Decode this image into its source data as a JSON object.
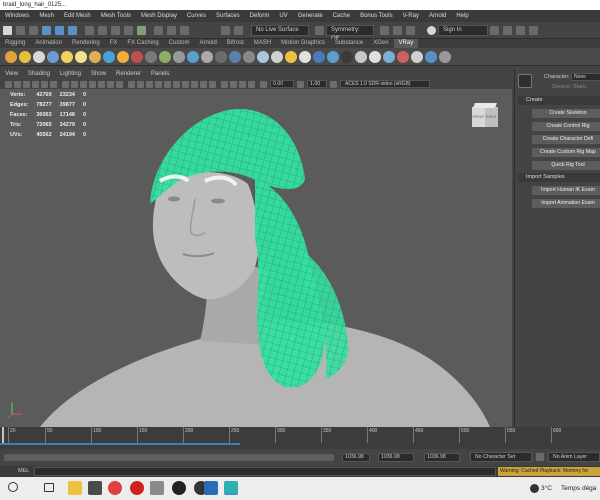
{
  "title_bar": {
    "text": "braid_long_hair_0125..."
  },
  "menubar": [
    "Windows",
    "Mesh",
    "Edit Mesh",
    "Mesh Tools",
    "Mesh Display",
    "Curves",
    "Surfaces",
    "Deform",
    "UV",
    "Generate",
    "Cache",
    "Bonus Tools",
    "V-Ray",
    "Arnold",
    "Help"
  ],
  "statusline": {
    "live_surface": "No Live Surface",
    "symmetry": "Symmetry: Off",
    "sign_in": "Sign In"
  },
  "shelf_tabs": [
    "Rigging",
    "Animation",
    "Rendering",
    "FX",
    "FX Caching",
    "Custom",
    "Arnold",
    "Bifrost",
    "MASH",
    "Motion Graphics",
    "Substance",
    "XGen",
    "VRay"
  ],
  "shelf_active_tab": "VRay",
  "panel_menu": [
    "View",
    "Shading",
    "Lighting",
    "Show",
    "Renderer",
    "Panels"
  ],
  "viewport_toolbar": {
    "field_a": "0.00",
    "field_b": "1.00",
    "color_space": "ACES 1.0 SDR-video (sRGB)"
  },
  "hud": {
    "rows": [
      {
        "label": "Verts:",
        "v1": "42769",
        "v2": "23234",
        "v3": "0"
      },
      {
        "label": "Edges:",
        "v1": "78277",
        "v2": "39877",
        "v3": "0"
      },
      {
        "label": "Faces:",
        "v1": "36063",
        "v2": "17148",
        "v3": "0"
      },
      {
        "label": "Tris:",
        "v1": "72065",
        "v2": "34279",
        "v3": "0"
      },
      {
        "label": "UVs:",
        "v1": "45562",
        "v2": "24194",
        "v3": "0"
      }
    ]
  },
  "viewcube": {
    "front": "FRONT",
    "right": "RIGHT"
  },
  "right_panel": {
    "character_label": "Character:",
    "character_value": "None",
    "source_label": "Source:",
    "source_value": "Stanc",
    "create_header": "Create",
    "create_buttons": [
      "Create Skeleton",
      "Create Control Rig",
      "Create Character Defi",
      "Create Custom Rig Map",
      "Quick Rig Tool"
    ],
    "import_header": "Import Samples",
    "import_buttons": [
      "Import Human IK Exam",
      "Import Animation Exam"
    ]
  },
  "timeline": {
    "ticks": [
      "20",
      "50",
      "100",
      "150",
      "200",
      "250",
      "300",
      "350",
      "400",
      "450",
      "500",
      "550",
      "600"
    ]
  },
  "range": {
    "field1": "1036.98",
    "field2": "1036.98",
    "field3": "1036.98",
    "character_set": "No Character Set",
    "anim_layer": "No Anim Layer"
  },
  "mel": {
    "label": "MEL",
    "warning": "Warning: Cached Playback: Memory for"
  },
  "taskbar": {
    "tray_text": "Temps déga",
    "temp": "3°C"
  },
  "colors": {
    "wireframe": "#35e0a0",
    "viewport_bg": "#5b5b5b",
    "model": "#b8b8b8"
  }
}
